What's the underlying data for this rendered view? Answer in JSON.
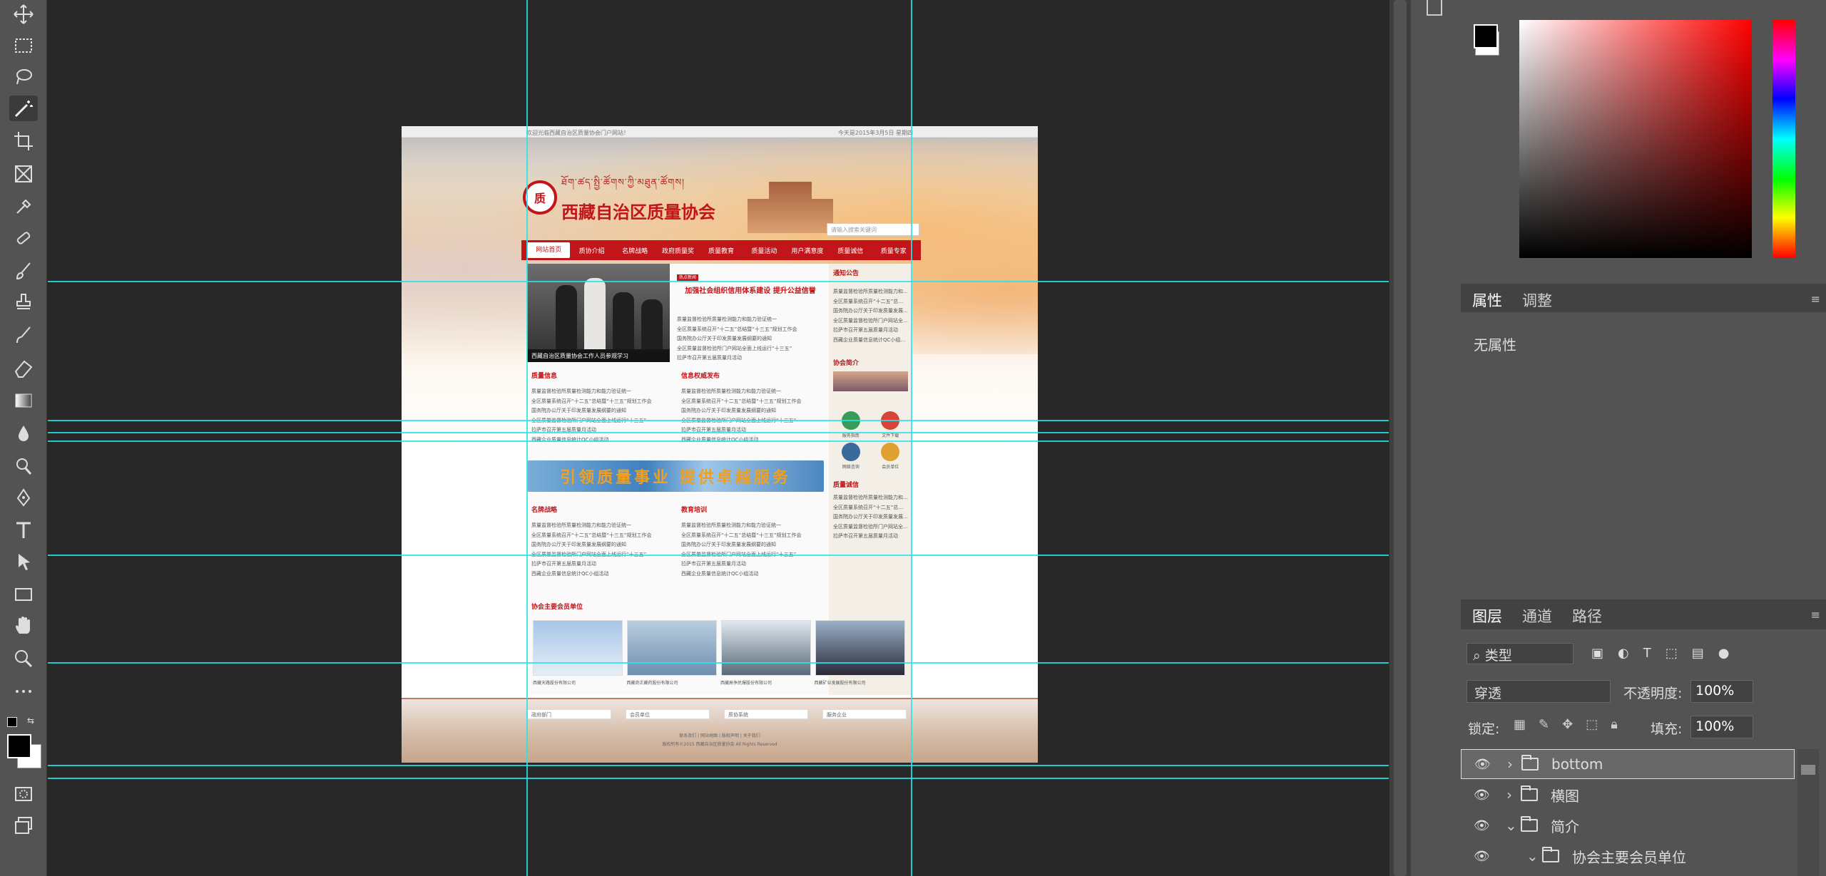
{
  "app": {
    "accent": "#27e4ea"
  },
  "tools": [
    "move-icon",
    "marquee-icon",
    "lasso-icon",
    "magic-wand-icon",
    "crop-icon",
    "frame-icon",
    "eyedropper-icon",
    "healing-icon",
    "brush-icon",
    "stamp-icon",
    "history-brush-icon",
    "eraser-icon",
    "gradient-icon",
    "blur-icon",
    "dodge-icon",
    "pen-icon",
    "type-icon",
    "path-select-icon",
    "rectangle-icon",
    "hand-icon",
    "zoom-icon",
    "more-icon"
  ],
  "page": {
    "topbar_left": "欢迎光临西藏自治区质量协会门户网站！",
    "topbar_right": "今天是2015年3月5日 星期四",
    "logo_tibetan": "ཐོག་ཚད་སྤྱི་ཚོགས་ཀྱི་མཐུན་ཚོགས།",
    "logo_title": "西藏自治区质量协会",
    "search_placeholder": "请输入搜索关键词",
    "nav": [
      "网站首页",
      "质协介绍",
      "名牌战略",
      "政府质量奖",
      "质量教育",
      "质量活动",
      "用户满意度",
      "质量诚信",
      "质量专家"
    ],
    "headline": "加强社会组织信用体系建设 提升公益信誉",
    "headline_badge": "热点新闻",
    "slide_caption": "西藏自治区质量协会工作人员参观学习",
    "notice_title": "通知公告",
    "news": [
      "质量监督检验所质量检测能力和能力验证统一",
      "全区质量系统召开“十二五”总结暨“十三五”规划工作会",
      "国务院办公厅关于印发质量发展纲要的通知",
      "全区质量监督检验所门户网站全面上线运行“十三五”",
      "拉萨市召开第五届质量月活动",
      "西藏企业质量信息统计QC小组活动"
    ],
    "sections": {
      "quality_info": "质量信息",
      "info_publish": "信息权威发布",
      "brand": "名牌战略",
      "education": "教育培训",
      "intro": "协会简介",
      "credit": "质量诚信",
      "members": "协会主要会员单位"
    },
    "banner": "引领质量事业 提供卓越服务",
    "side_icons": [
      "服务指南",
      "文件下载",
      "网络咨询",
      "会员单位"
    ],
    "member_names": [
      "西藏天路股份有限公司",
      "西藏奇正藏药股份有限公司",
      "西藏高争民爆股份有限公司",
      "西藏矿业发展股份有限公司"
    ],
    "footer_selects": [
      "政府部门",
      "会员单位",
      "质协系统",
      "服务企业"
    ],
    "footer_links": "联系我们 | 网站地图 | 版权声明 | 关于我们",
    "footer_copy": "版权所有©2015 西藏自治区质量协会 All Rights Reserved"
  },
  "panels": {
    "prop_tabs": [
      "属性",
      "调整"
    ],
    "no_props": "无属性",
    "layer_tabs": [
      "图层",
      "通道",
      "路径"
    ],
    "kind": "类型",
    "blend": "穿透",
    "opacity_label": "不透明度:",
    "opacity_value": "100%",
    "lock_label": "锁定:",
    "fill_label": "填充:",
    "fill_value": "100%",
    "layers": [
      "bottom",
      "横图",
      "简介",
      "协会主要会员单位"
    ]
  }
}
